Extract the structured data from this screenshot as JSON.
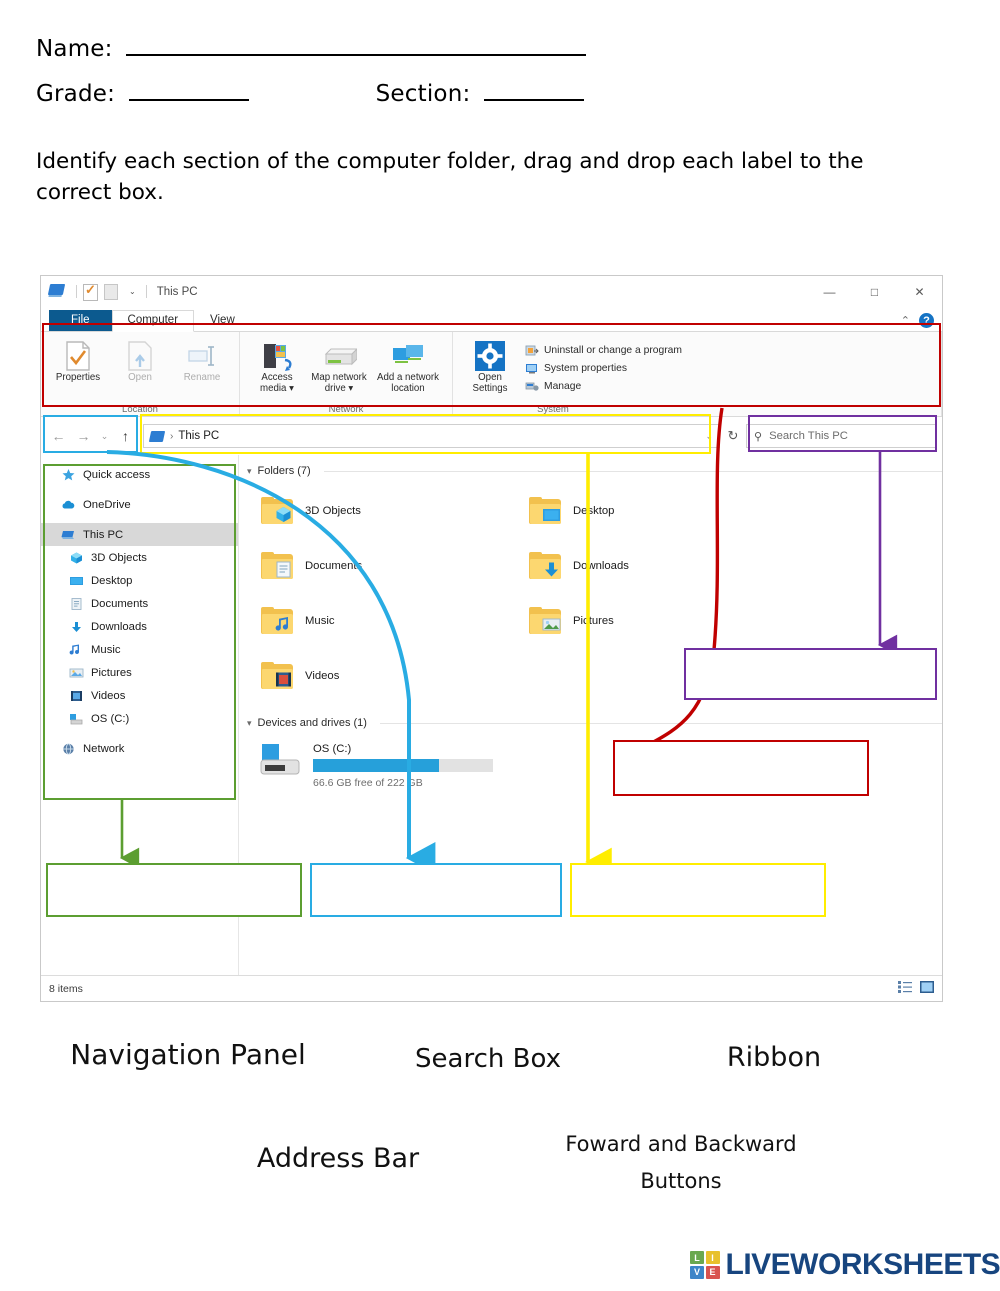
{
  "worksheet": {
    "name_label": "Name:",
    "grade_label": "Grade:",
    "section_label": "Section:",
    "instructions": "Identify each section of the computer folder, drag and drop each label to the correct box."
  },
  "explorer": {
    "titlebar": {
      "title": "This PC",
      "minimize": "—",
      "maximize": "□",
      "close": "✕",
      "collapse_ribbon": "⌃",
      "help": "?"
    },
    "tabs": [
      {
        "label": "File",
        "state": "file"
      },
      {
        "label": "Computer",
        "state": "active"
      },
      {
        "label": "View",
        "state": "normal"
      }
    ],
    "ribbon": {
      "groups": [
        {
          "label": "Location",
          "buttons": [
            {
              "label": "Properties",
              "icon": "properties-icon",
              "dim": false
            },
            {
              "label": "Open",
              "icon": "open-icon",
              "dim": true
            },
            {
              "label": "Rename",
              "icon": "rename-icon",
              "dim": true
            }
          ]
        },
        {
          "label": "Network",
          "buttons": [
            {
              "label": "Access media ▾",
              "icon": "access-media-icon",
              "dim": false
            },
            {
              "label": "Map network drive ▾",
              "icon": "map-network-drive-icon",
              "dim": false
            },
            {
              "label": "Add a network location",
              "icon": "add-network-location-icon",
              "dim": false
            }
          ]
        },
        {
          "label": "System",
          "buttons": [
            {
              "label": "Open Settings",
              "icon": "settings-gear-icon",
              "dim": false
            }
          ],
          "list": [
            {
              "label": "Uninstall or change a program",
              "icon": "uninstall-icon"
            },
            {
              "label": "System properties",
              "icon": "system-properties-icon"
            },
            {
              "label": "Manage",
              "icon": "manage-icon"
            }
          ]
        }
      ]
    },
    "addressbar": {
      "back": "←",
      "forward": "→",
      "recent": "⌄",
      "up": "↑",
      "separator": "›",
      "path": "This PC",
      "dropdown": "⌄",
      "refresh": "↻"
    },
    "search": {
      "placeholder": "Search This PC",
      "icon": "search-icon"
    },
    "navpane": {
      "items": [
        {
          "label": "Quick access",
          "icon": "star-icon",
          "indent": false,
          "selected": false
        },
        {
          "label": "OneDrive",
          "icon": "cloud-icon",
          "indent": false,
          "selected": false
        },
        {
          "label": "This PC",
          "icon": "pc-icon",
          "indent": false,
          "selected": true
        },
        {
          "label": "3D Objects",
          "icon": "3d-objects-icon",
          "indent": true,
          "selected": false
        },
        {
          "label": "Desktop",
          "icon": "desktop-icon",
          "indent": true,
          "selected": false
        },
        {
          "label": "Documents",
          "icon": "documents-icon",
          "indent": true,
          "selected": false
        },
        {
          "label": "Downloads",
          "icon": "downloads-icon",
          "indent": true,
          "selected": false
        },
        {
          "label": "Music",
          "icon": "music-icon",
          "indent": true,
          "selected": false
        },
        {
          "label": "Pictures",
          "icon": "pictures-icon",
          "indent": true,
          "selected": false
        },
        {
          "label": "Videos",
          "icon": "videos-icon",
          "indent": true,
          "selected": false
        },
        {
          "label": "OS (C:)",
          "icon": "drive-icon",
          "indent": true,
          "selected": false
        },
        {
          "label": "Network",
          "icon": "network-icon",
          "indent": false,
          "selected": false
        }
      ]
    },
    "content": {
      "folders_header": "Folders (7)",
      "folders": [
        {
          "label": "3D Objects",
          "icon": "3d-objects-icon"
        },
        {
          "label": "Desktop",
          "icon": "desktop-icon"
        },
        {
          "label": "Documents",
          "icon": "documents-icon"
        },
        {
          "label": "Downloads",
          "icon": "downloads-icon"
        },
        {
          "label": "Music",
          "icon": "music-icon"
        },
        {
          "label": "Pictures",
          "icon": "pictures-icon"
        },
        {
          "label": "Videos",
          "icon": "videos-icon"
        }
      ],
      "drives_header": "Devices and drives (1)",
      "drive": {
        "name": "OS (C:)",
        "free_text": "66.6 GB free of 222 GB",
        "used_percent": 70
      }
    },
    "statusbar": {
      "items": "8 items",
      "view_details": "details-view-icon",
      "view_large": "large-icons-view-icon"
    }
  },
  "highlights": [
    {
      "name": "ribbon-highlight",
      "color": "#c00000"
    },
    {
      "name": "nav-buttons-highlight",
      "color": "#29ace3"
    },
    {
      "name": "address-bar-highlight",
      "color": "#ffed00"
    },
    {
      "name": "search-box-highlight",
      "color": "#7030a0"
    },
    {
      "name": "navigation-panel-highlight",
      "color": "#5c9e31"
    }
  ],
  "answer_boxes": [
    {
      "name": "answer-box-navigation-panel",
      "color": "#5c9e31",
      "value": ""
    },
    {
      "name": "answer-box-forward-backward",
      "color": "#29ace3",
      "value": ""
    },
    {
      "name": "answer-box-address-bar",
      "color": "#ffed00",
      "value": ""
    },
    {
      "name": "answer-box-search-box",
      "color": "#7030a0",
      "value": ""
    },
    {
      "name": "answer-box-ribbon",
      "color": "#c00000",
      "value": ""
    }
  ],
  "drag_labels": [
    {
      "text": "Navigation Panel",
      "name": "drag-label-navigation-panel"
    },
    {
      "text": "Search Box",
      "name": "drag-label-search-box"
    },
    {
      "text": "Ribbon",
      "name": "drag-label-ribbon"
    },
    {
      "text": "Address Bar",
      "name": "drag-label-address-bar"
    },
    {
      "text": "Foward and Backward Buttons",
      "name": "drag-label-forward-backward-buttons"
    }
  ],
  "branding": {
    "wordmark": "LIVEWORKSHEETS",
    "tiles": [
      {
        "letter": "L",
        "color": "#6aa84f"
      },
      {
        "letter": "I",
        "color": "#e8c12c"
      },
      {
        "letter": "V",
        "color": "#3d85c8"
      },
      {
        "letter": "E",
        "color": "#d9534f"
      }
    ]
  }
}
